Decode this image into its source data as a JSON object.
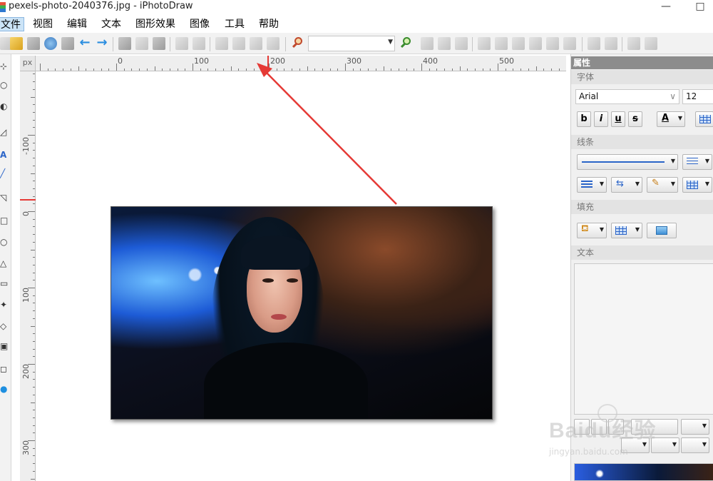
{
  "window": {
    "title": "pexels-photo-2040376.jpg - iPhotoDraw",
    "minimize_glyph": "—",
    "maximize_glyph": "□"
  },
  "menu": {
    "items": [
      "文件",
      "视图",
      "编辑",
      "文本",
      "图形效果",
      "图像",
      "工具",
      "帮助"
    ],
    "active_index": 0
  },
  "toolbar": {
    "zoom_value": "",
    "icons": [
      "new-icon",
      "open-icon",
      "save-icon",
      "web-icon",
      "print-icon",
      "undo-icon",
      "redo-icon",
      "cut-icon",
      "copy-icon",
      "paste-icon",
      "crop-icon",
      "rotate-icon",
      "edit-icon",
      "brush-icon",
      "paint-bucket-icon",
      "perspective-icon",
      "zoom-out-icon",
      "zoom-in-icon"
    ]
  },
  "ruler": {
    "unit": "px",
    "top_labels": [
      "0",
      "100",
      "200",
      "300",
      "400",
      "500"
    ],
    "left_labels": [
      "-100",
      "0",
      "100",
      "200",
      "300"
    ]
  },
  "properties": {
    "header": "属性",
    "font_section": "字体",
    "font_name": "Arial",
    "font_size": "12",
    "bold": "b",
    "italic": "i",
    "underline": "u",
    "strike": "s",
    "font_color_letter": "A",
    "line_section": "线条",
    "fill_section": "填充",
    "text_section": "文本"
  },
  "watermark": {
    "brand": "Baidu经验",
    "url": "jingyan.baidu.com"
  },
  "colors": {
    "annotation_arrow": "#e53935",
    "menu_active_bg": "#cce4f7",
    "panel_header": "#8c8c8c"
  }
}
